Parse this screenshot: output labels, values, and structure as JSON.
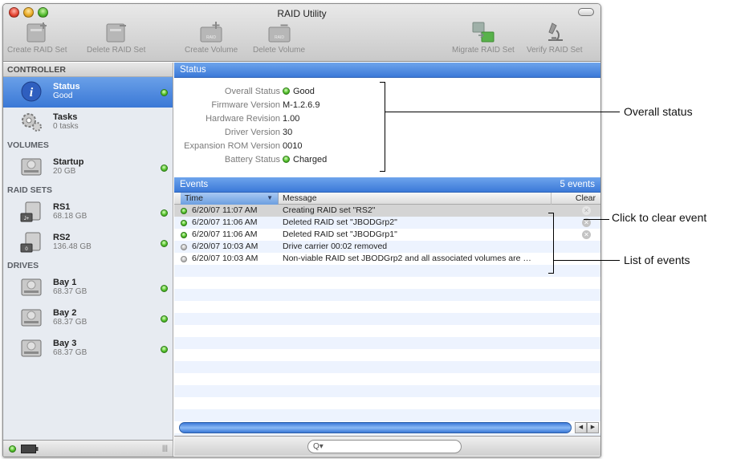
{
  "window": {
    "title": "RAID Utility"
  },
  "toolbar": {
    "create_raid_set": "Create RAID Set",
    "delete_raid_set": "Delete RAID Set",
    "create_volume": "Create Volume",
    "delete_volume": "Delete Volume",
    "migrate_raid_set": "Migrate RAID Set",
    "verify_raid_set": "Verify RAID Set"
  },
  "sidebar": {
    "controller_header": "CONTROLLER",
    "status_item": {
      "name": "Status",
      "sub": "Good"
    },
    "tasks_item": {
      "name": "Tasks",
      "sub": "0 tasks"
    },
    "volumes_header": "VOLUMES",
    "volumes": [
      {
        "name": "Startup",
        "sub": "20 GB"
      }
    ],
    "raidsets_header": "RAID SETS",
    "raidsets": [
      {
        "name": "RS1",
        "sub": "68.18 GB"
      },
      {
        "name": "RS2",
        "sub": "136.48 GB"
      }
    ],
    "drives_header": "DRIVES",
    "drives": [
      {
        "name": "Bay 1",
        "sub": "68.37 GB"
      },
      {
        "name": "Bay 2",
        "sub": "68.37 GB"
      },
      {
        "name": "Bay 3",
        "sub": "68.37 GB"
      }
    ],
    "resize_glyph": "|||"
  },
  "status": {
    "header": "Status",
    "rows": [
      {
        "label": "Overall Status",
        "value": "Good",
        "led": true
      },
      {
        "label": "Firmware Version",
        "value": "M-1.2.6.9"
      },
      {
        "label": "Hardware Revision",
        "value": "1.00"
      },
      {
        "label": "Driver Version",
        "value": "30"
      },
      {
        "label": "Expansion ROM Version",
        "value": "0010"
      },
      {
        "label": "Battery Status",
        "value": "Charged",
        "led": true
      }
    ]
  },
  "events": {
    "header": "Events",
    "count": "5 events",
    "col_time": "Time",
    "col_message": "Message",
    "col_clear": "Clear",
    "sort_arrow": "▼",
    "rows": [
      {
        "time": "6/20/07 11:07 AM",
        "message": "Creating RAID set \"RS2\"",
        "led": "green",
        "clear": true,
        "selected": true
      },
      {
        "time": "6/20/07 11:06 AM",
        "message": "Deleted RAID set \"JBODGrp2\"",
        "led": "green",
        "clear": true
      },
      {
        "time": "6/20/07 11:06 AM",
        "message": "Deleted RAID set \"JBODGrp1\"",
        "led": "green",
        "clear": true
      },
      {
        "time": "6/20/07 10:03 AM",
        "message": "Drive carrier 00:02 removed",
        "led": "gray",
        "clear": false
      },
      {
        "time": "6/20/07 10:03 AM",
        "message": "Non-viable RAID set JBODGrp2 and all associated volumes are …",
        "led": "gray",
        "clear": false
      }
    ]
  },
  "search": {
    "icon": "Q▾",
    "placeholder": ""
  },
  "scroll": {
    "left": "◀",
    "right": "▶"
  },
  "callouts": {
    "overall_status": "Overall status",
    "click_to_clear": "Click to clear event",
    "list_of_events": "List of events"
  }
}
